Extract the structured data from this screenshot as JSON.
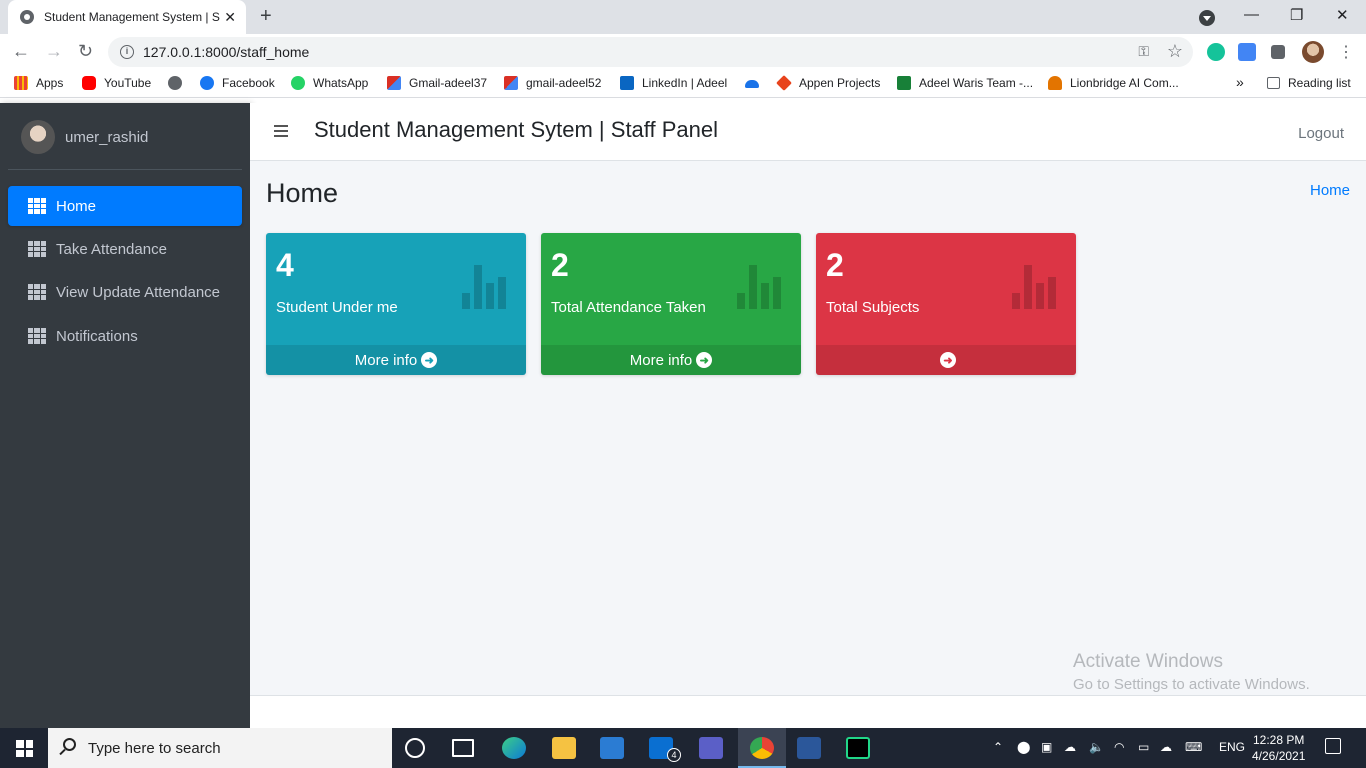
{
  "browser": {
    "tab_title": "Student Management System | St",
    "url": "127.0.0.1:8000/staff_home",
    "bookmarks": [
      {
        "label": "Apps",
        "color": "#ea4335"
      },
      {
        "label": "YouTube",
        "color": "#ff0000"
      },
      {
        "label": "",
        "color": "#5f6368"
      },
      {
        "label": "Facebook",
        "color": "#1877f2"
      },
      {
        "label": "WhatsApp",
        "color": "#25d366"
      },
      {
        "label": "Gmail-adeel37",
        "color": "#d93025"
      },
      {
        "label": "gmail-adeel52",
        "color": "#d93025"
      },
      {
        "label": "LinkedIn | Adeel",
        "color": "#0a66c2"
      },
      {
        "label": "",
        "color": "#1a73e8"
      },
      {
        "label": "Appen Projects",
        "color": "#e8431c"
      },
      {
        "label": "Adeel Waris Team -...",
        "color": "#188038"
      },
      {
        "label": "Lionbridge AI Com...",
        "color": "#e37400"
      }
    ],
    "more_bookmarks": "»",
    "reading_list": "Reading list"
  },
  "sidebar": {
    "username": "umer_rashid",
    "items": [
      {
        "label": "Home",
        "active": true
      },
      {
        "label": "Take Attendance",
        "active": false
      },
      {
        "label": "View Update Attendance",
        "active": false
      },
      {
        "label": "Notifications",
        "active": false
      }
    ]
  },
  "header": {
    "title": "Student Management Sytem | Staff Panel",
    "logout": "Logout"
  },
  "main": {
    "page_title": "Home",
    "breadcrumb": "Home",
    "cards": [
      {
        "count": "4",
        "label": "Student Under me",
        "footer": "More info",
        "color": "#17a2b8"
      },
      {
        "count": "2",
        "label": "Total Attendance Taken",
        "footer": "More info",
        "color": "#28a745"
      },
      {
        "count": "2",
        "label": "Total Subjects",
        "footer": "",
        "color": "#dc3545"
      }
    ]
  },
  "watermark": {
    "line1": "Activate Windows",
    "line2": "Go to Settings to activate Windows."
  },
  "taskbar": {
    "search_placeholder": "Type here to search",
    "mail_badge": "4",
    "language": "ENG",
    "time": "12:28 PM",
    "date": "4/26/2021"
  }
}
